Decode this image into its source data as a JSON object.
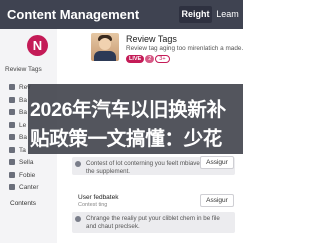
{
  "header": {
    "title": "Content Management",
    "nav_primary": "Reight",
    "nav_secondary": "Leam"
  },
  "sidebar": {
    "avatar_initial": "N",
    "name": "Review Tags",
    "items": [
      {
        "label": "Rev",
        "icon": "grid-icon"
      },
      {
        "label": "Ba",
        "icon": "grid-icon"
      },
      {
        "label": "Ba",
        "icon": "list-icon"
      },
      {
        "label": "Le",
        "icon": "list-icon"
      },
      {
        "label": "Ba",
        "icon": "layers-icon"
      },
      {
        "label": "Ta",
        "icon": "tag-icon"
      },
      {
        "label": "Sella",
        "icon": "tag-icon"
      },
      {
        "label": "Fobie",
        "icon": "folder-icon"
      },
      {
        "label": "Canter",
        "icon": "settings-icon"
      }
    ],
    "section_label": "Contents"
  },
  "profile": {
    "title": "Review Tags",
    "description": "Review tag aging too mirenlatich a made.",
    "badges": [
      "LIVE",
      "2",
      "3+"
    ]
  },
  "feed": [
    {
      "text": "Contest of lot conterning you feelt mbiave ad you'll the supplement.",
      "action": "Assigur"
    },
    {
      "user": "User fedbatek",
      "sub": "Contest ting",
      "text": "Chrange the realiy put your cliblet chem in be file and chaut preclsek.",
      "action": "Assigur"
    }
  ],
  "overlay": {
    "line1": "2026年汽车以旧换新补",
    "line2": "贴政策一文搞懂：少花"
  },
  "colors": {
    "topbar": "#3f4351",
    "accent": "#c41b57",
    "sidebar": "#f4f4f6"
  }
}
